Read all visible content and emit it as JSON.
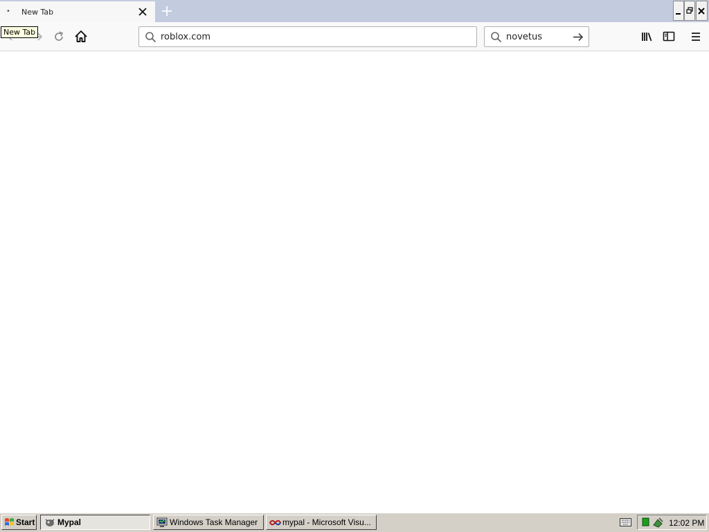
{
  "browser": {
    "tabs": [
      {
        "title": "New Tab",
        "active": true
      }
    ],
    "tooltip": "New Tab",
    "url": "roblox.com",
    "search_query": "novetus"
  },
  "icons": {
    "tab_close": "close-icon",
    "new_tab": "plus-icon",
    "back": "arrow-left-icon",
    "forward": "arrow-right-icon",
    "reload": "reload-icon",
    "home": "home-icon",
    "url_search": "search-icon",
    "search": "search-icon",
    "search_go": "arrow-right-icon",
    "library": "library-icon",
    "sidebar": "sidebar-icon",
    "menu": "hamburger-menu-icon",
    "minimize": "minimize-icon",
    "restore": "restore-icon",
    "close": "close-icon"
  },
  "taskbar": {
    "start_label": "Start",
    "tasks": [
      {
        "label": "Mypal",
        "active": true
      },
      {
        "label": "Windows Task Manager",
        "active": false
      },
      {
        "label": "mypal - Microsoft Visu...",
        "active": false
      }
    ],
    "clock": "12:02 PM"
  },
  "colors": {
    "tabstrip": "#c3cbdf",
    "tab_active": "#f7f7f8",
    "toolbar": "#f9f9fa",
    "taskbar": "#d4d0c8",
    "tooltip_bg": "#ffffe1"
  }
}
